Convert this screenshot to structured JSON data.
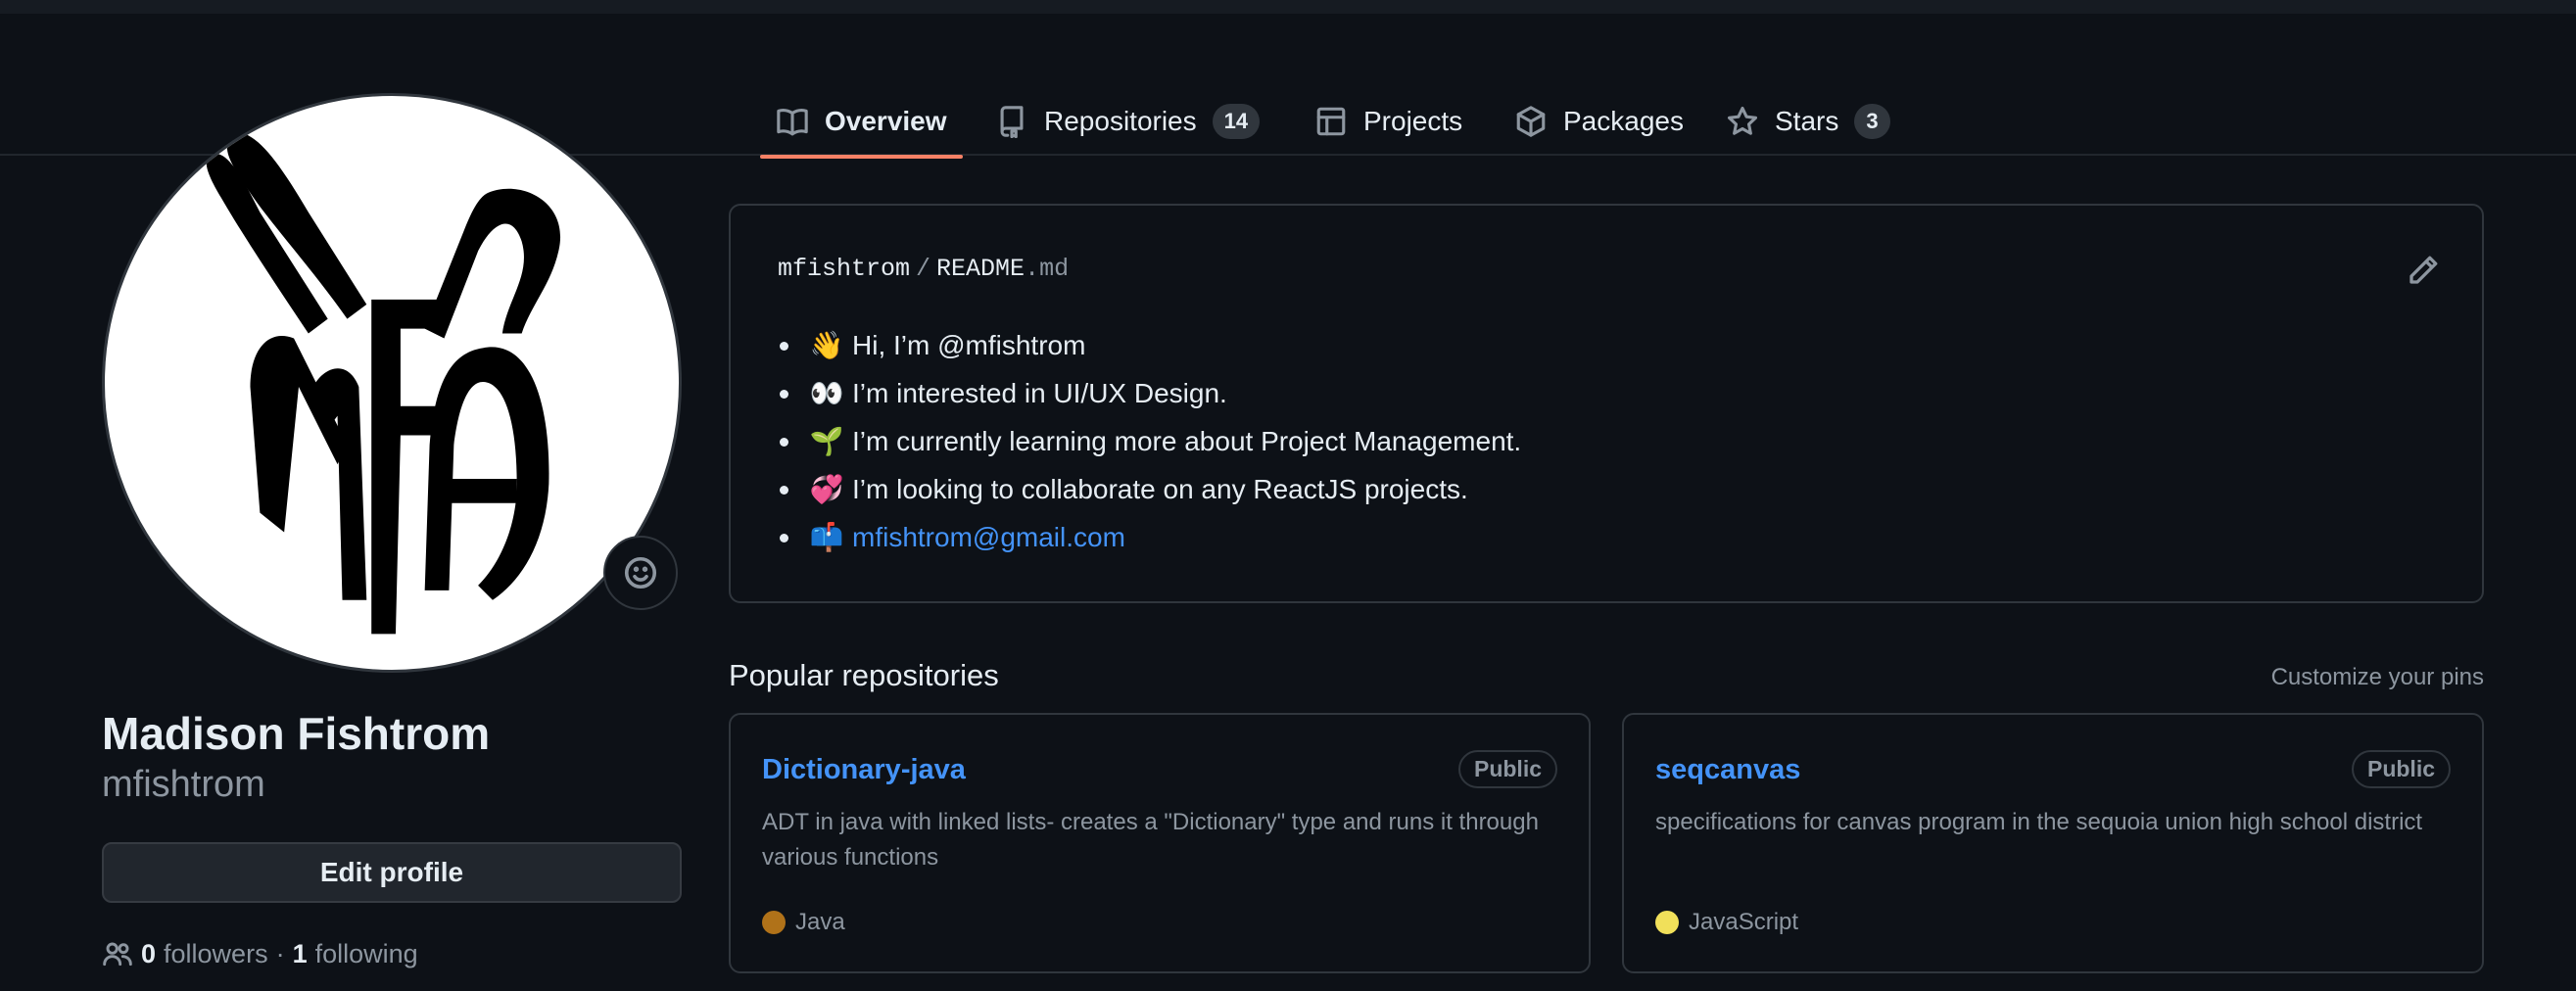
{
  "tabs": [
    {
      "label": "Overview",
      "icon": "book-icon",
      "active": true
    },
    {
      "label": "Repositories",
      "icon": "repo-icon",
      "count": "14"
    },
    {
      "label": "Projects",
      "icon": "table-icon"
    },
    {
      "label": "Packages",
      "icon": "package-icon"
    },
    {
      "label": "Stars",
      "icon": "star-icon",
      "count": "3"
    }
  ],
  "profile": {
    "avatar_text": "MFA",
    "full_name": "Madison Fishtrom",
    "username": "mfishtrom",
    "edit_button": "Edit profile",
    "followers_count": "0",
    "followers_label": "followers",
    "separator": "·",
    "following_count": "1",
    "following_label": "following"
  },
  "readme": {
    "owner": "mfishtrom",
    "slash": "/",
    "file": "README",
    "ext": ".md",
    "items": [
      {
        "emoji": "👋",
        "text": "Hi, I’m @mfishtrom"
      },
      {
        "emoji": "👀",
        "text": "I’m interested in UI/UX Design."
      },
      {
        "emoji": "🌱",
        "text": "I’m currently learning more about Project Management."
      },
      {
        "emoji": "💞️",
        "text": "I’m looking to collaborate on any ReactJS projects."
      },
      {
        "emoji": "📫",
        "text": "",
        "link": "mfishtrom@gmail.com"
      }
    ]
  },
  "popular": {
    "title": "Popular repositories",
    "customize": "Customize your pins",
    "repos": [
      {
        "name": "Dictionary-java",
        "visibility": "Public",
        "description": "ADT in java with linked lists- creates a \"Dictionary\" type and runs it through various functions",
        "language": "Java",
        "language_color": "#b07219"
      },
      {
        "name": "seqcanvas",
        "visibility": "Public",
        "description": "specifications for canvas program in the sequoia union high school district",
        "language": "JavaScript",
        "language_color": "#f1e05a"
      }
    ]
  },
  "colors": {
    "background": "#0d1117",
    "accent_underline": "#f78166",
    "link": "#4493f8",
    "muted": "#8d96a0"
  }
}
